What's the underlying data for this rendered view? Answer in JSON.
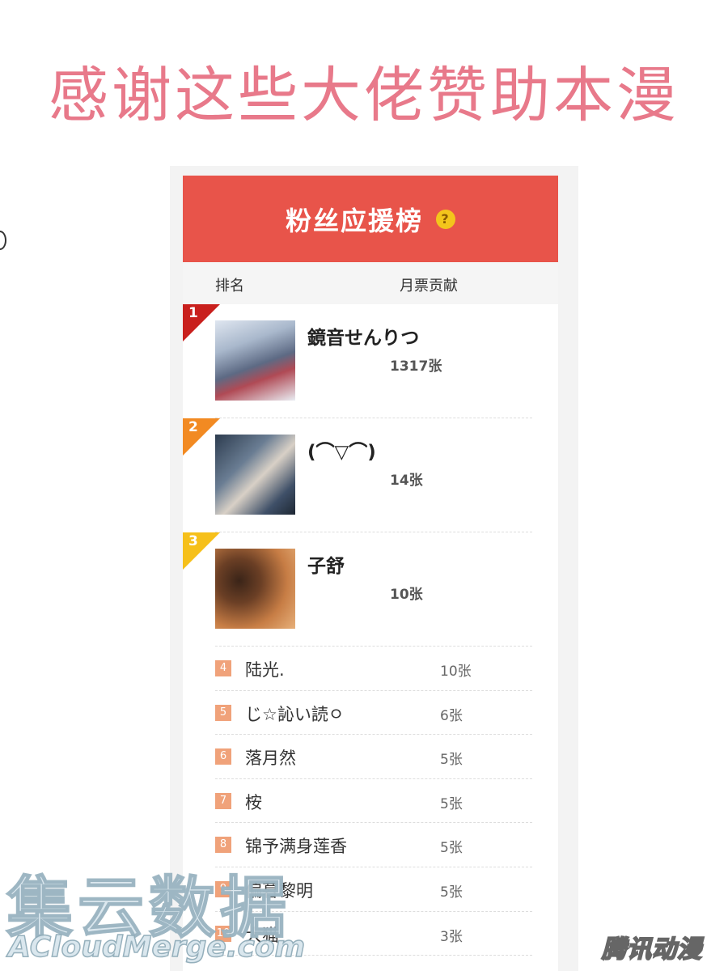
{
  "banner": {
    "text": "感谢这些大佬赞助本漫"
  },
  "panel": {
    "title": "粉丝应援榜",
    "help_icon": "?",
    "columns": {
      "rank": "排名",
      "votes": "月票贡献"
    }
  },
  "top_fans": [
    {
      "rank": "1",
      "name": "鏡音せんりつ",
      "count": "1317张",
      "corner_color": "#c9201d"
    },
    {
      "rank": "2",
      "name": "(⌒▽⌒)",
      "count": "14张",
      "corner_color": "#f28a22"
    },
    {
      "rank": "3",
      "name": "子舒",
      "count": "10张",
      "corner_color": "#f6c01a"
    }
  ],
  "fans": [
    {
      "rank": "4",
      "name": "陆光.",
      "count": "10张"
    },
    {
      "rank": "5",
      "name": "じ☆訫い読ㅇ",
      "count": "6张"
    },
    {
      "rank": "6",
      "name": "落月然",
      "count": "5张"
    },
    {
      "rank": "7",
      "name": "桉",
      "count": "5张"
    },
    {
      "rank": "8",
      "name": "锦予满身莲香",
      "count": "5张"
    },
    {
      "rank": "9",
      "name": "偏暮黎明",
      "count": "5张"
    },
    {
      "rank": "10",
      "name": "大猫",
      "count": "3张"
    }
  ],
  "watermark": {
    "text": "集云数据",
    "sub": "ACloudMerge.com"
  },
  "logo": {
    "text": "腾讯动漫"
  }
}
